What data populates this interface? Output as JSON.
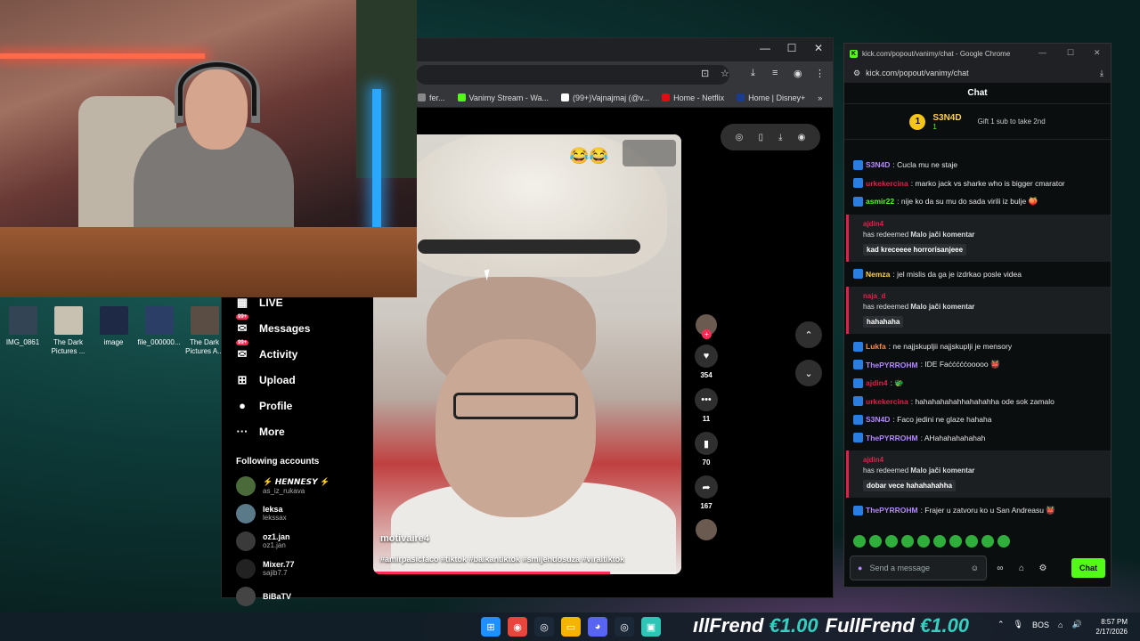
{
  "desktop": {
    "icons": [
      {
        "label": "IMG_0861",
        "color": "#334455"
      },
      {
        "label": "The Dark Pictures ...",
        "color": "#c8c0b0"
      },
      {
        "label": "image",
        "color": "#1e2a45"
      },
      {
        "label": "file_000000...",
        "color": "#2a3e66"
      },
      {
        "label": "The Dark Pictures A...",
        "color": "#5a4e44"
      }
    ]
  },
  "browser": {
    "controls": {
      "minimize": "—",
      "maximize": "☐",
      "close": "✕"
    },
    "bookmarks": [
      {
        "label": "fer...",
        "color": "#888888"
      },
      {
        "label": "Vanimy Stream - Wa...",
        "color": "#53fc18"
      },
      {
        "label": "(99+)Vajnajmaj (@v...",
        "color": "#ffffff"
      },
      {
        "label": "Home - Netflix",
        "color": "#e50914"
      },
      {
        "label": "Home | Disney+",
        "color": "#1a3c8c"
      }
    ],
    "bookmarks_more": "»"
  },
  "tiktok": {
    "nav": [
      {
        "label": "LIVE",
        "icon": "live-icon",
        "glyph": "▦"
      },
      {
        "label": "Messages",
        "icon": "messages-icon",
        "glyph": "✉",
        "badge": "99+"
      },
      {
        "label": "Activity",
        "icon": "activity-icon",
        "glyph": "✉",
        "badge": "99+"
      },
      {
        "label": "Upload",
        "icon": "upload-icon",
        "glyph": "⊞"
      },
      {
        "label": "Profile",
        "icon": "profile-icon",
        "glyph": "●"
      },
      {
        "label": "More",
        "icon": "more-icon",
        "glyph": "···"
      }
    ],
    "following_title": "Following accounts",
    "accounts": [
      {
        "name": "⚡ 𝙃𝙀𝙉𝙉𝙀𝙎𝙔 ⚡",
        "handle": "as_iz_rukava",
        "color": "#4a6a3a"
      },
      {
        "name": "leksa",
        "handle": "lekssax",
        "color": "#5a7a8a"
      },
      {
        "name": "oz1.jan",
        "handle": "oz1.jan",
        "color": "#3a3a3a"
      },
      {
        "name": "Mixer.77",
        "handle": "sajib7.7",
        "color": "#222222"
      },
      {
        "name": "BiBaTV",
        "handle": "",
        "color": "#444444"
      }
    ],
    "video": {
      "username": "motivaire4",
      "hashtags": "#amirpasicfaco #tiktok #balkantiktok #smijehdosuza #viraltiktok",
      "progress": 0.77,
      "overlay_emojis": "😂😂"
    },
    "actions": [
      {
        "icon": "like-icon",
        "glyph": "♥",
        "count": "354"
      },
      {
        "icon": "comment-icon",
        "glyph": "•••",
        "count": "11"
      },
      {
        "icon": "bookmark-icon",
        "glyph": "▮",
        "count": "70"
      },
      {
        "icon": "share-icon",
        "glyph": "➦",
        "count": "167"
      }
    ],
    "nav_up": "⌃",
    "nav_down": "⌄"
  },
  "chat": {
    "window_title": "kick.com/popout/vanimy/chat - Google Chrome",
    "url": "kick.com/popout/vanimy/chat",
    "header": "Chat",
    "gifter": {
      "rank": "1",
      "name": "S3N4D",
      "count": "1",
      "text": "Gift 1 sub to take 2nd"
    },
    "messages": [
      {
        "type": "msg",
        "user": "S3N4D",
        "color": "#b388ff",
        "text": ": Cucla mu ne staje"
      },
      {
        "type": "msg",
        "user": "urkekercina",
        "color": "#e0204a",
        "text": ": marko jack vs sharke who is bigger cmarator"
      },
      {
        "type": "msg",
        "user": "asmir22",
        "color": "#53fc18",
        "text": ": nije ko da su mu do sada virili iz bulje 🍑"
      },
      {
        "type": "redeem",
        "user": "ajdin4",
        "text": "has redeemed",
        "reward": "Malo jači komentar",
        "value": "kad kreceeee horrorisanjeee"
      },
      {
        "type": "msg",
        "user": "Nemza",
        "color": "#ffd24a",
        "text": ": jel mislis da ga je izdrkao posle videa"
      },
      {
        "type": "redeem",
        "user": "naja_d",
        "text": "has redeemed",
        "reward": "Malo jači komentar",
        "value": "hahahaha"
      },
      {
        "type": "msg",
        "user": "Lukfa",
        "color": "#ff8a3d",
        "text": ": ne najjskupljii najjskuplji je mensory"
      },
      {
        "type": "msg",
        "user": "ThePYRROHM",
        "color": "#b388ff",
        "text": ": IDE Faćććććooooo 👹"
      },
      {
        "type": "msg",
        "user": "ajdin4",
        "color": "#e0204a",
        "text": ": 🐲"
      },
      {
        "type": "msg",
        "user": "urkekercina",
        "color": "#e0204a",
        "text": ": hahahahahahhahahahha ode sok zamalo"
      },
      {
        "type": "msg",
        "user": "S3N4D",
        "color": "#b388ff",
        "text": ": Faco jedini ne glaze hahaha"
      },
      {
        "type": "msg",
        "user": "ThePYRROHM",
        "color": "#b388ff",
        "text": ": AHahahahahahah"
      },
      {
        "type": "redeem",
        "user": "ajdin4",
        "text": "has redeemed",
        "reward": "Malo jači komentar",
        "value": "dobar vece hahahahahha"
      },
      {
        "type": "msg",
        "user": "ThePYRROHM",
        "color": "#b388ff",
        "text": ": Frajer u zatvoru ko u San Andreasu 👹"
      }
    ],
    "input_placeholder": "Send a message",
    "send_label": "Chat"
  },
  "taskbar": {
    "banner": [
      {
        "name": "ıllFrend",
        "price": "€1.00"
      },
      {
        "name": "FullFrend",
        "price": "€1.00"
      }
    ],
    "tray_lang": "BOS",
    "tray_chevron": "⌃",
    "time": "8:57 PM",
    "date": "2/17/2026"
  }
}
